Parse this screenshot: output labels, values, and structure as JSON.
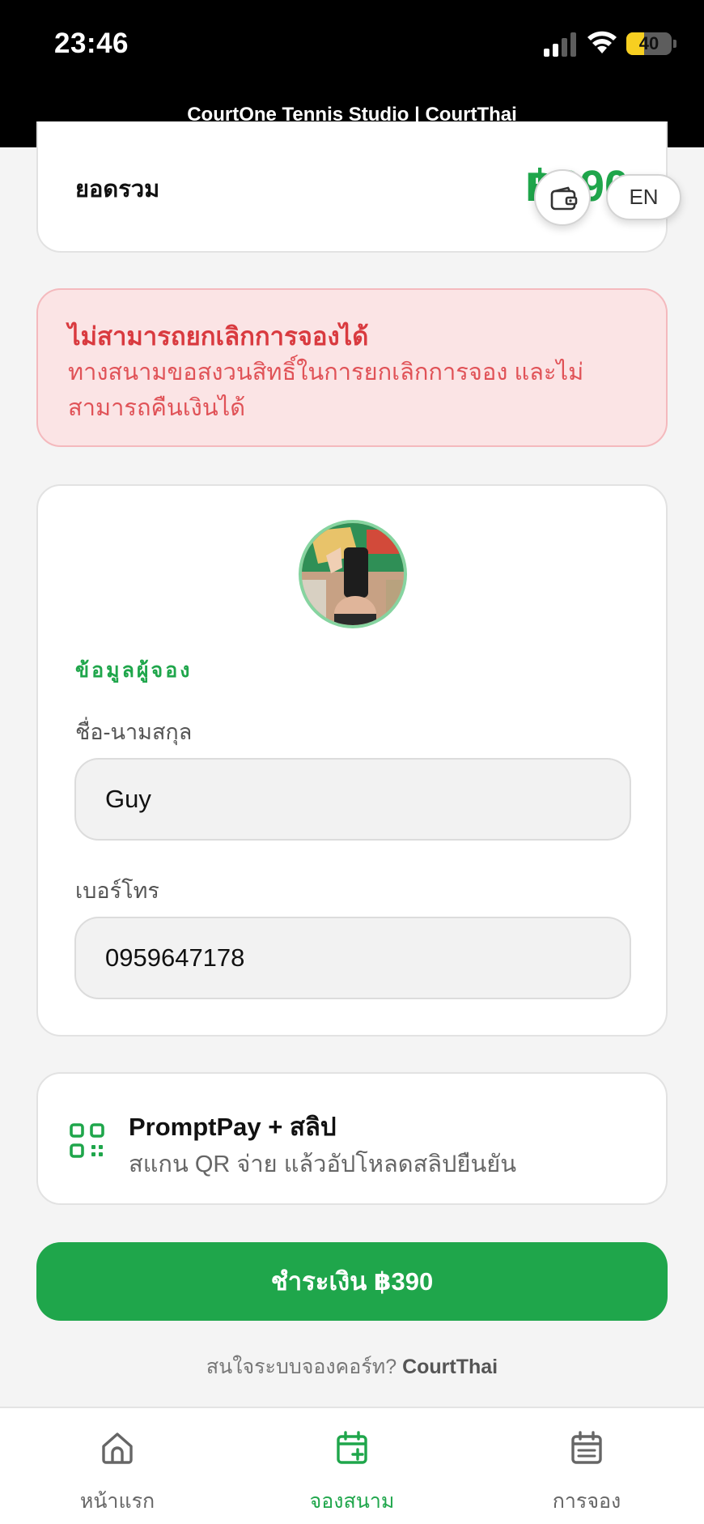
{
  "status_bar": {
    "time": "23:46",
    "battery": "40",
    "battery_fraction": 0.4
  },
  "header": {
    "title": "CourtOne Tennis Studio | CourtThai"
  },
  "summary": {
    "total_label": "ยอดรวม",
    "total_amount": "฿390"
  },
  "floating": {
    "wallet_icon": "wallet-icon",
    "lang_label": "EN"
  },
  "warning": {
    "title": "ไม่สามารถยกเลิกการจองได้",
    "text": "ทางสนามขอสงวนสิทธิ์ในการยกเลิกการจอง และไม่สามารถคืนเงินได้"
  },
  "booker": {
    "section_label": "ข้อมูลผู้จอง",
    "name_label": "ชื่อ-นามสกุล",
    "name_value": "Guy",
    "phone_label": "เบอร์โทร",
    "phone_value": "0959647178"
  },
  "payment_method": {
    "icon": "qr-code-icon",
    "title": "PromptPay + สลิป",
    "subtitle": "สแกน QR จ่าย แล้วอัปโหลดสลิปยืนยัน"
  },
  "pay_button": {
    "label": "ชำระเงิน ฿390"
  },
  "footer": {
    "prompt": "สนใจระบบจองคอร์ท?",
    "brand": "CourtThai"
  },
  "bottom_nav": [
    {
      "label": "หน้าแรก",
      "icon": "home-icon",
      "active": false
    },
    {
      "label": "จองสนาม",
      "icon": "calendar-plus-icon",
      "active": true
    },
    {
      "label": "การจอง",
      "icon": "calendar-list-icon",
      "active": false
    }
  ],
  "colors": {
    "accent": "#1fa64b",
    "warning_bg": "#fbe4e5",
    "warning_text": "#d93a3f",
    "battery": "#f7cf21"
  }
}
